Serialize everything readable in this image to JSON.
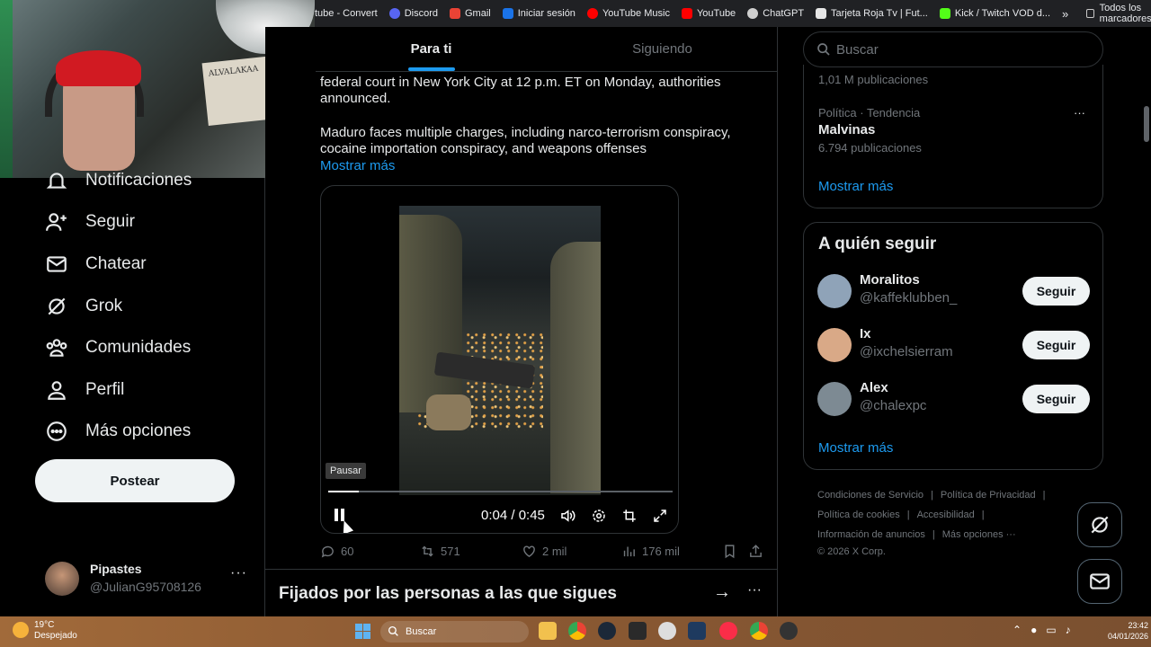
{
  "bookmarks": {
    "items": [
      {
        "label": "tube - Convert",
        "icon": "convert-icon",
        "color": "#202124"
      },
      {
        "label": "Discord",
        "icon": "discord-icon",
        "color": "#5865f2"
      },
      {
        "label": "Gmail",
        "icon": "gmail-icon",
        "color": "#ea4335"
      },
      {
        "label": "Iniciar sesión",
        "icon": "login-icon",
        "color": "#1a73e8"
      },
      {
        "label": "YouTube Music",
        "icon": "youtube-music-icon",
        "color": "#ff0000"
      },
      {
        "label": "YouTube",
        "icon": "youtube-icon",
        "color": "#ff0000"
      },
      {
        "label": "ChatGPT",
        "icon": "chatgpt-icon",
        "color": "#cfcfcf"
      },
      {
        "label": "Tarjeta Roja Tv | Fut...",
        "icon": "tarjeta-roja-icon",
        "color": "#e6e6e6"
      },
      {
        "label": "Kick / Twitch VOD d...",
        "icon": "kick-icon",
        "color": "#53fc18"
      }
    ],
    "overflow": "»",
    "all_label": "Todos los marcadores"
  },
  "webcam": {
    "sign_text": "ALVALAKAA"
  },
  "nav": {
    "items": [
      {
        "label": "Notificaciones",
        "icon": "bell-icon"
      },
      {
        "label": "Seguir",
        "icon": "follow-icon"
      },
      {
        "label": "Chatear",
        "icon": "mail-icon"
      },
      {
        "label": "Grok",
        "icon": "grok-icon"
      },
      {
        "label": "Comunidades",
        "icon": "communities-icon"
      },
      {
        "label": "Perfil",
        "icon": "profile-icon"
      },
      {
        "label": "Más opciones",
        "icon": "more-options-icon"
      }
    ],
    "post_label": "Postear",
    "user": {
      "name": "Pipastes",
      "handle": "@JulianG95708126",
      "dots": "···"
    }
  },
  "feed": {
    "tabs": [
      {
        "label": "Para ti",
        "active": true
      },
      {
        "label": "Siguiendo",
        "active": false
      }
    ],
    "text_line1": "federal court in New York City at 12 p.m. ET on Monday, authorities",
    "text_line2": "announced.",
    "text_line3": "Maduro faces multiple charges, including narco-terrorism conspiracy,",
    "text_line4": "cocaine importation conspiracy, and weapons offenses",
    "more_label": "Mostrar más",
    "video": {
      "tooltip": "Pausar",
      "time": "0:04 / 0:45",
      "progress": 0.09
    },
    "actions": {
      "replies": "60",
      "reposts": "571",
      "likes": "2 mil",
      "views": "176 mil"
    },
    "pinned_title": "Fijados por las personas a las que sigues",
    "pinned_arrow": "→",
    "pinned_dots": "···"
  },
  "right": {
    "search_placeholder": "Buscar",
    "trend0_count": "1,01 M publicaciones",
    "trend1_category": "Política · Tendencia",
    "trend1_name": "Malvinas",
    "trend1_count": "6.794 publicaciones",
    "trend_dots": "···",
    "trends_more": "Mostrar más",
    "follow_title": "A quién seguir",
    "follow": [
      {
        "name": "Moralitos",
        "handle": "@kaffeklubben_",
        "button": "Seguir",
        "color": "#8fa3b8"
      },
      {
        "name": "Ix",
        "handle": "@ixchelsierram",
        "button": "Seguir",
        "color": "#d9a987"
      },
      {
        "name": "Alex",
        "handle": "@chalexpc",
        "button": "Seguir",
        "color": "#7d8a93"
      }
    ],
    "follow_more": "Mostrar más",
    "footer": {
      "terms": "Condiciones de Servicio",
      "privacy": "Política de Privacidad",
      "cookies": "Política de cookies",
      "accessibility": "Accesibilidad",
      "ads": "Información de anuncios",
      "more": "Más opciones ···",
      "copyright": "© 2026 X Corp.",
      "sep": "|"
    }
  },
  "taskbar": {
    "temperature": "19°C",
    "weather": "Despejado",
    "search_label": "Buscar",
    "time": "23:42",
    "date": "04/01/2026"
  }
}
